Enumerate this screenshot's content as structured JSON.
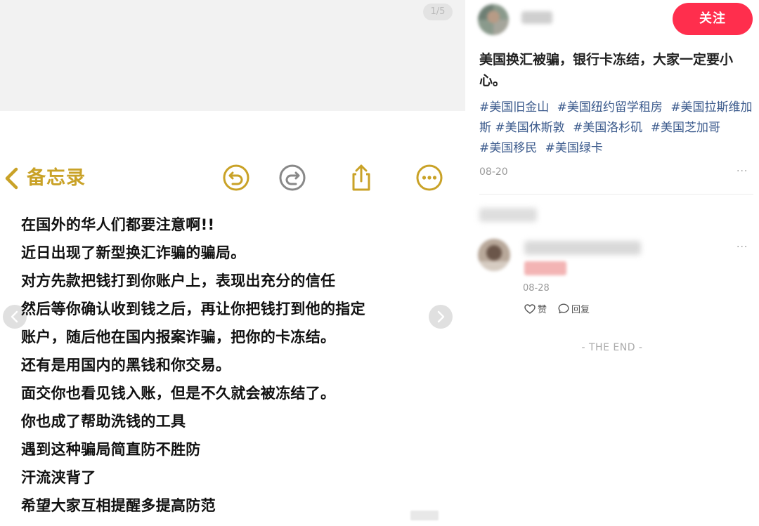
{
  "image_viewer": {
    "page_counter": "1/5"
  },
  "notes_app": {
    "back_label": "备忘录",
    "accent_color": "#c9a227",
    "toolbar_icons": [
      "undo-icon",
      "redo-icon",
      "share-icon",
      "more-icon"
    ],
    "lines": [
      "在国外的华人们都要注意啊!!",
      "近日出现了新型换汇诈骗的骗局。",
      "对方先款把钱打到你账户上，表现出充分的信任",
      "然后等你确认收到钱之后，再让你把钱打到他的指定",
      "账户，随后他在国内报案诈骗，把你的卡冻结。",
      "还有是用国内的黑钱和你交易。",
      "面交你也看见钱入账，但是不久就会被冻结了。",
      "你也成了帮助洗钱的工具",
      "遇到这种骗局简直防不胜防",
      "汗流浃背了",
      "希望大家互相提醒多提高防范"
    ]
  },
  "post": {
    "follow_label": "关注",
    "follow_color": "#ff2e4d",
    "title": "美国换汇被骗，银行卡冻结，大家一定要小心。",
    "tags": [
      "#美国旧金山",
      "#美国纽约留学租房",
      "#美国拉斯维加斯",
      "#美国休斯敦",
      "#美国洛杉矶",
      "#美国芝加哥",
      "#美国移民",
      "#美国绿卡"
    ],
    "tag_color": "#3b5a8c",
    "date": "08-20",
    "more": "···"
  },
  "comment": {
    "date": "08-28",
    "like_label": "赞",
    "reply_label": "回复",
    "more": "···"
  },
  "footer": {
    "end_label": "- THE END -"
  }
}
